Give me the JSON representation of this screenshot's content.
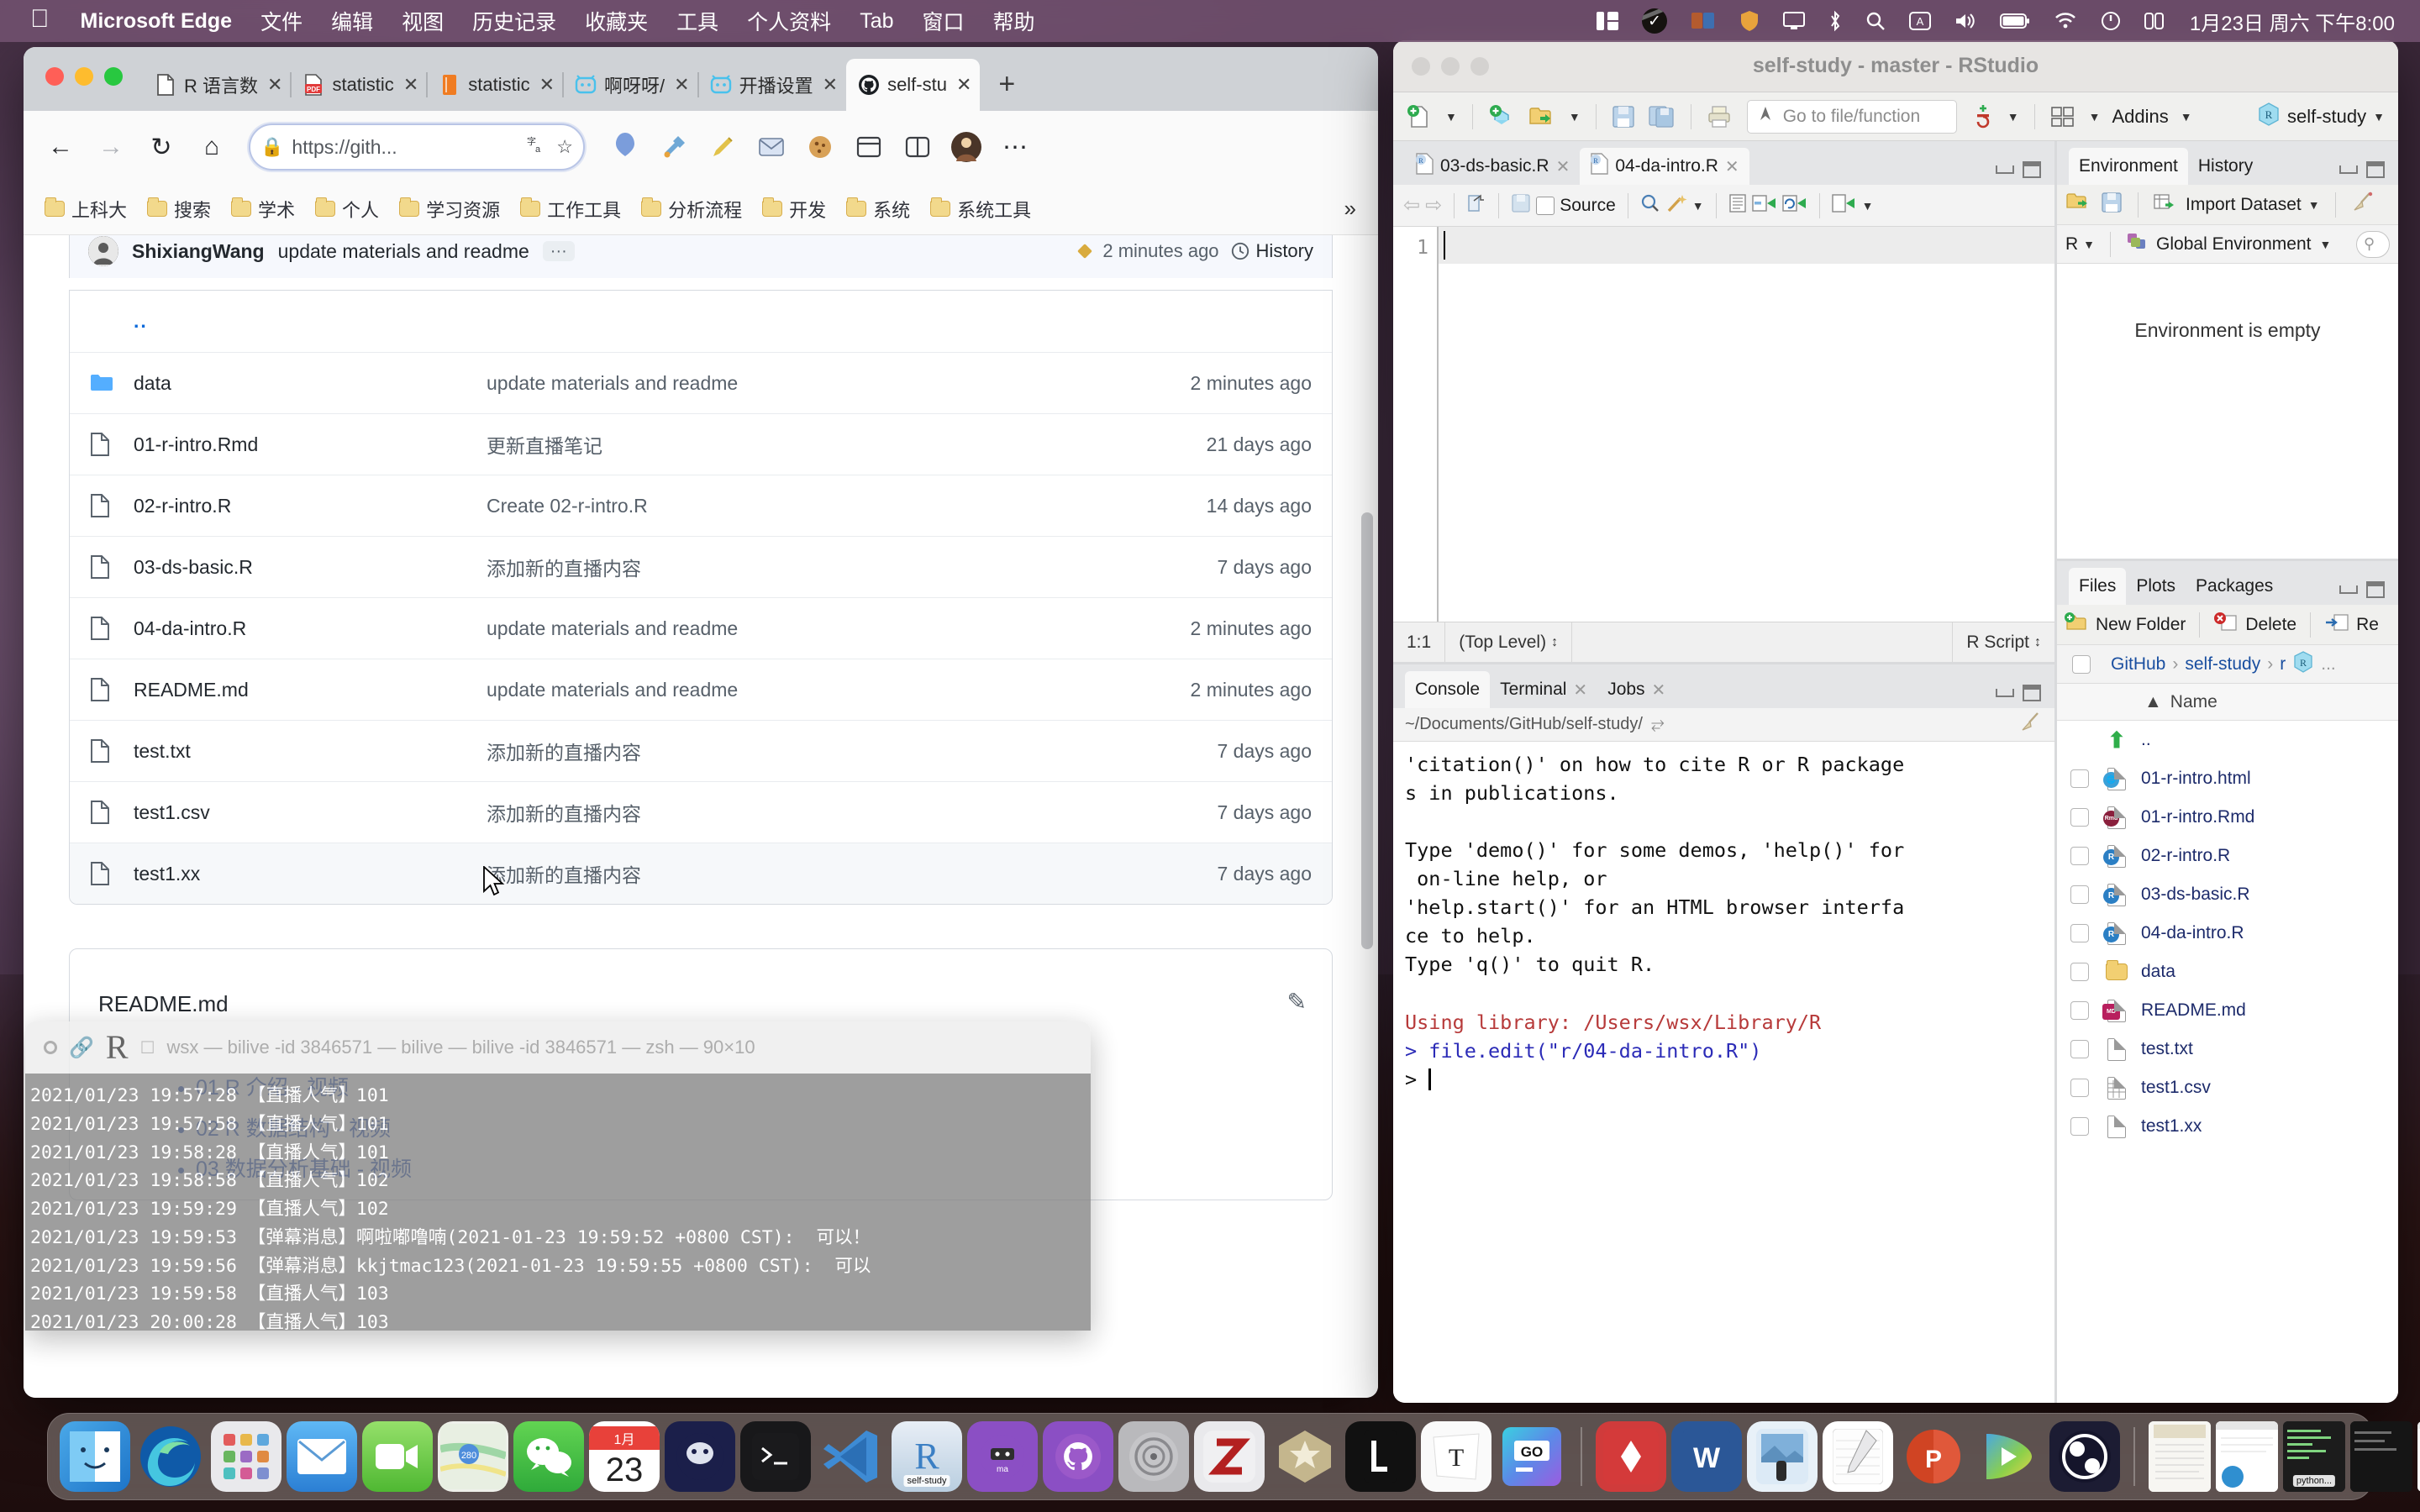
{
  "menubar": {
    "apple": "apple-logo",
    "app_name": "Microsoft Edge",
    "items": [
      "文件",
      "编辑",
      "视图",
      "历史记录",
      "收藏夹",
      "工具",
      "个人资料",
      "Tab",
      "窗口",
      "帮助"
    ],
    "status_icons": [
      "split-view-icon",
      "checkmark-circle-icon",
      "image-stack-icon",
      "shield-icon",
      "display-icon",
      "bluetooth-icon",
      "search-icon",
      "chinese-input-icon",
      "volume-icon",
      "battery-icon",
      "wifi-icon",
      "power-icon",
      "control-center-icon"
    ],
    "datetime": "1月23日 周六 下午8:00"
  },
  "edge": {
    "tabs": [
      {
        "title": "R 语言数",
        "favicon": "page-icon",
        "active": false
      },
      {
        "title": "statistic",
        "favicon": "pdf-icon",
        "active": false
      },
      {
        "title": "statistic",
        "favicon": "book-icon",
        "active": false
      },
      {
        "title": "啊呀呀/",
        "favicon": "bilibili-icon",
        "active": false
      },
      {
        "title": "开播设置",
        "favicon": "bilibili-icon",
        "active": false
      },
      {
        "title": "self-stu",
        "favicon": "github-icon",
        "active": true
      }
    ],
    "new_tab": "+",
    "toolbar": {
      "back": "back-arrow-icon",
      "forward": "forward-arrow-icon",
      "reload": "reload-icon",
      "home": "home-icon",
      "lock": "lock-icon",
      "url": "https://gith...",
      "translate": "translate-icon",
      "favorite": "star-plus-icon",
      "extensions": [
        "balloon-icon",
        "tools-icon",
        "pen-icon",
        "mail-icon",
        "cookie-icon",
        "collections-icon",
        "split-icon",
        "profile-avatar"
      ],
      "more": "ellipsis-icon"
    },
    "bookmarks": [
      "上科大",
      "搜索",
      "学术",
      "个人",
      "学习资源",
      "工作工具",
      "分析流程",
      "开发",
      "系统",
      "系统工具"
    ],
    "bookmarks_overflow": "»"
  },
  "github": {
    "commit": {
      "author": "ShixiangWang",
      "message": "update materials and readme",
      "dots": "···",
      "time": "2 minutes ago",
      "history_label": "History",
      "history_icon": "clock-icon"
    },
    "columns": [
      "name",
      "message",
      "time"
    ],
    "parent_dir": "..",
    "files": [
      {
        "name": "data",
        "type": "folder",
        "message": "update materials and readme",
        "time": "2 minutes ago"
      },
      {
        "name": "01-r-intro.Rmd",
        "type": "file",
        "message": "更新直播笔记",
        "time": "21 days ago"
      },
      {
        "name": "02-r-intro.R",
        "type": "file",
        "message": "Create 02-r-intro.R",
        "time": "14 days ago"
      },
      {
        "name": "03-ds-basic.R",
        "type": "file",
        "message": "添加新的直播内容",
        "time": "7 days ago"
      },
      {
        "name": "04-da-intro.R",
        "type": "file",
        "message": "update materials and readme",
        "time": "2 minutes ago"
      },
      {
        "name": "README.md",
        "type": "file",
        "message": "update materials and readme",
        "time": "2 minutes ago"
      },
      {
        "name": "test.txt",
        "type": "file",
        "message": "添加新的直播内容",
        "time": "7 days ago"
      },
      {
        "name": "test1.csv",
        "type": "file",
        "message": "添加新的直播内容",
        "time": "7 days ago"
      },
      {
        "name": "test1.xx",
        "type": "file",
        "message": "添加新的直播内容",
        "time": "7 days ago"
      }
    ],
    "readme": {
      "title": "README.md",
      "edit_icon": "pencil-icon",
      "links": [
        "01 R 介绍 - 视频",
        "02 R 数据结构 - 视频",
        "03 数据分析基础 - 视频"
      ]
    }
  },
  "terminal": {
    "title": "wsx — bilive -id 3846571 — bilive — bilive -id 3846571 — zsh — 90×10",
    "app_letter": "R",
    "lines": [
      "2021/01/23 19:57:28 【直播人气】101",
      "2021/01/23 19:57:58 【直播人气】101",
      "2021/01/23 19:58:28 【直播人气】101",
      "2021/01/23 19:58:58 【直播人气】102",
      "2021/01/23 19:59:29 【直播人气】102",
      "2021/01/23 19:59:53 【弹幕消息】啊啦嘟噜喃(2021-01-23 19:59:52 +0800 CST):  可以！",
      "2021/01/23 19:59:56 【弹幕消息】kkjtmac123(2021-01-23 19:59:55 +0800 CST):  可以",
      "2021/01/23 19:59:58 【直播人气】103",
      "2021/01/23 20:00:28 【直播人气】103"
    ]
  },
  "rstudio": {
    "title": "self-study - master - RStudio",
    "toolbar": {
      "new_file": "new-file-icon",
      "new_project": "new-project-icon",
      "open_file": "open-folder-icon",
      "save": "save-icon",
      "save_all": "save-all-icon",
      "print": "print-icon",
      "goto_placeholder": "Go to file/function",
      "goto_icon": "navigate-icon",
      "workspace": "workspace-icon",
      "panes": "panes-icon",
      "addins_label": "Addins",
      "project_label": "self-study"
    },
    "source": {
      "tabs": [
        {
          "label": "03-ds-basic.R",
          "active": false
        },
        {
          "label": "04-da-intro.R",
          "active": true
        }
      ],
      "editor_toolbar": [
        "back-icon",
        "forward-icon",
        "popout-icon",
        "save-icon",
        "source-checkbox",
        "find-icon",
        "magic-wand-icon",
        "outline-icon",
        "run-icon",
        "rerun-icon",
        "source-run-icon"
      ],
      "source_label": "Source",
      "line_number": "1",
      "status": {
        "position": "1:1",
        "scope": "(Top Level)",
        "type": "R Script"
      }
    },
    "console": {
      "tabs": [
        {
          "label": "Console",
          "active": true,
          "closeable": false
        },
        {
          "label": "Terminal",
          "active": false,
          "closeable": true
        },
        {
          "label": "Jobs",
          "active": false,
          "closeable": true
        }
      ],
      "path": "~/Documents/GitHub/self-study/",
      "path_icon": "arrow-icon",
      "broom_icon": "broom-icon",
      "output": [
        {
          "text": "'citation()' on how to cite R or R package",
          "color": "black"
        },
        {
          "text": "s in publications.",
          "color": "black"
        },
        {
          "text": "",
          "color": "black"
        },
        {
          "text": "Type 'demo()' for some demos, 'help()' for",
          "color": "black"
        },
        {
          "text": " on-line help, or",
          "color": "black"
        },
        {
          "text": "'help.start()' for an HTML browser interfa",
          "color": "black"
        },
        {
          "text": "ce to help.",
          "color": "black"
        },
        {
          "text": "Type 'q()' to quit R.",
          "color": "black"
        },
        {
          "text": "",
          "color": "black"
        },
        {
          "text": "Using library: /Users/wsx/Library/R",
          "color": "red"
        },
        {
          "text": "> file.edit(\"r/04-da-intro.R\")",
          "color": "blue"
        }
      ],
      "prompt": ">"
    },
    "environment": {
      "tabs": [
        {
          "label": "Environment",
          "active": true
        },
        {
          "label": "History",
          "active": false
        }
      ],
      "toolbar": [
        "load-icon",
        "save-icon",
        "import-dataset-label",
        "broom-icon"
      ],
      "import_label": "Import Dataset",
      "language": "R",
      "scope": "Global Environment",
      "empty_message": "Environment is empty"
    },
    "files": {
      "tabs": [
        {
          "label": "Files",
          "active": true
        },
        {
          "label": "Plots",
          "active": false
        },
        {
          "label": "Packages",
          "active": false
        }
      ],
      "actions": [
        {
          "label": "New Folder",
          "icon": "new-folder-icon"
        },
        {
          "label": "Delete",
          "icon": "delete-icon"
        },
        {
          "label": "Re",
          "icon": "rename-icon"
        }
      ],
      "breadcrumbs": [
        "GitHub",
        "self-study",
        "r"
      ],
      "breadcrumb_more": "...",
      "column_name": "Name",
      "sort_icon": "sort-asc-icon",
      "rows": [
        {
          "name": "..",
          "icon": "up-folder-icon",
          "checkbox": false
        },
        {
          "name": "01-r-intro.html",
          "icon": "html-icon",
          "checkbox": true
        },
        {
          "name": "01-r-intro.Rmd",
          "icon": "rmd-icon",
          "checkbox": true
        },
        {
          "name": "02-r-intro.R",
          "icon": "r-icon",
          "checkbox": true
        },
        {
          "name": "03-ds-basic.R",
          "icon": "r-icon",
          "checkbox": true
        },
        {
          "name": "04-da-intro.R",
          "icon": "r-icon",
          "checkbox": true
        },
        {
          "name": "data",
          "icon": "folder-icon",
          "checkbox": true
        },
        {
          "name": "README.md",
          "icon": "md-icon",
          "checkbox": true
        },
        {
          "name": "test.txt",
          "icon": "text-icon",
          "checkbox": true
        },
        {
          "name": "test1.csv",
          "icon": "csv-icon",
          "checkbox": true
        },
        {
          "name": "test1.xx",
          "icon": "text-icon",
          "checkbox": true
        }
      ]
    }
  },
  "dock": {
    "apps": [
      {
        "name": "Finder",
        "running": true
      },
      {
        "name": "Microsoft Edge",
        "running": true
      },
      {
        "name": "Launchpad",
        "running": false
      },
      {
        "name": "Mail",
        "running": true
      },
      {
        "name": "FaceTime",
        "running": false
      },
      {
        "name": "Maps",
        "running": false
      },
      {
        "name": "WeChat",
        "running": true
      },
      {
        "name": "Calendar",
        "running": false,
        "label": "23",
        "sublabel": "1月"
      },
      {
        "name": "Zotero",
        "running": true
      },
      {
        "name": "iTerm",
        "running": true
      },
      {
        "name": "Visual Studio Code",
        "running": false
      },
      {
        "name": "RStudio",
        "running": true,
        "label": "self-study"
      },
      {
        "name": "Marked",
        "running": false
      },
      {
        "name": "GitHub Desktop",
        "running": true
      },
      {
        "name": "System Preferences",
        "running": false
      },
      {
        "name": "Zotero Z",
        "running": true
      },
      {
        "name": "Keka",
        "running": false
      },
      {
        "name": "Logseq",
        "running": false
      },
      {
        "name": "Typora",
        "running": false
      },
      {
        "name": "GoLand",
        "running": false
      },
      {
        "name": "DataGrip",
        "running": true
      },
      {
        "name": "Word",
        "running": true
      },
      {
        "name": "Preview",
        "running": true
      },
      {
        "name": "Notes",
        "running": true
      },
      {
        "name": "PowerPoint",
        "running": true
      },
      {
        "name": "Player",
        "running": true
      },
      {
        "name": "OBS",
        "running": true
      }
    ],
    "minimized": [
      {
        "name": "document-window"
      },
      {
        "name": "browser-window"
      },
      {
        "name": "terminal-window",
        "label": "python..."
      },
      {
        "name": "dark-terminal-window"
      },
      {
        "name": "notes-window"
      },
      {
        "name": "browser-window-2"
      },
      {
        "name": "photo-window"
      }
    ],
    "trash": "trash-icon"
  },
  "colors": {
    "accent_blue": "#0969da",
    "gh_text": "#24292f",
    "gh_muted": "#57606a",
    "console_red": "#b73a3a",
    "console_blue": "#2b2bb7",
    "menubar": "#785676"
  }
}
